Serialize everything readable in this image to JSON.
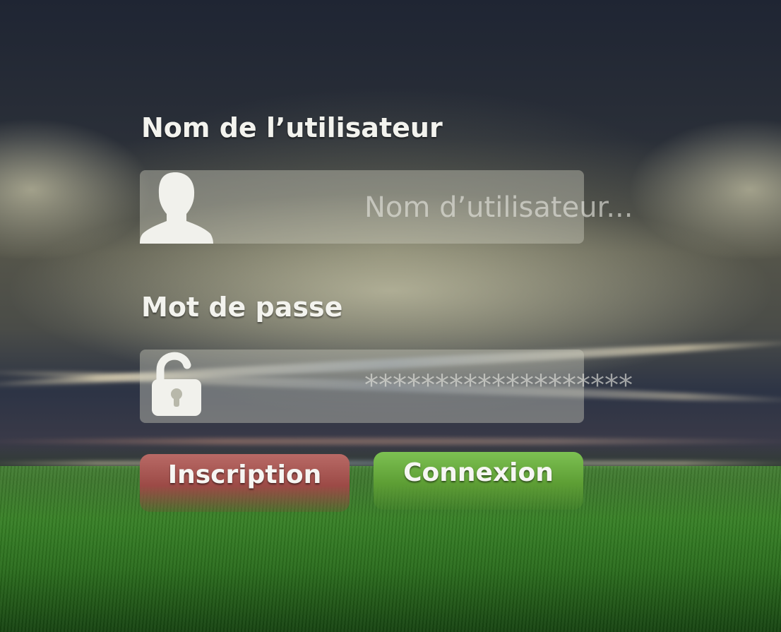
{
  "login": {
    "username_label": "Nom de l’utilisateur",
    "username_placeholder": "Nom d’utilisateur...",
    "password_label": "Mot de passe",
    "password_value": "*******************",
    "register_button": "Inscription",
    "login_button": "Connexion"
  },
  "icons": {
    "username_icon": "user-silhouette-icon",
    "password_icon": "open-padlock-icon"
  },
  "colors": {
    "register_button": "#a9514d",
    "login_button": "#6aad3e",
    "field_background": "#c8c8b8",
    "label_text": "#f3f3ee"
  }
}
